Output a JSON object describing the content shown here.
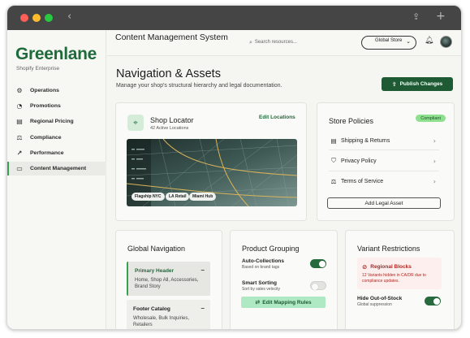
{
  "brand": {
    "name": "Greenlane",
    "subtitle": "Shopify Enterprise"
  },
  "sidebar": {
    "items": [
      {
        "label": "Operations",
        "icon": "sliders-icon",
        "glyph": "⚙"
      },
      {
        "label": "Promotions",
        "icon": "megaphone-icon",
        "glyph": "◔"
      },
      {
        "label": "Regional Pricing",
        "icon": "price-tag-icon",
        "glyph": "▤"
      },
      {
        "label": "Compliance",
        "icon": "gavel-icon",
        "glyph": "⚖"
      },
      {
        "label": "Performance",
        "icon": "trend-icon",
        "glyph": "↗"
      },
      {
        "label": "Content Management",
        "icon": "content-icon",
        "glyph": "▭",
        "active": true
      }
    ]
  },
  "header": {
    "app_title": "Content Management System",
    "search_placeholder": "Search resources...",
    "store_selector": "Global Store"
  },
  "page": {
    "title": "Navigation & Assets",
    "subtitle": "Manage your shop's structural hierarchy and legal documentation.",
    "publish_label": "Publish Changes"
  },
  "shop_locator": {
    "title": "Shop Locator",
    "subtitle": "42 Active Locations",
    "edit_label": "Edit Locations",
    "chips": [
      "Flagship NYC",
      "LA Retail",
      "Miami Hub"
    ]
  },
  "store_policies": {
    "title": "Store Policies",
    "badge": "Compliant",
    "items": [
      {
        "label": "Shipping & Returns",
        "icon": "clipboard-icon",
        "glyph": "▤"
      },
      {
        "label": "Privacy Policy",
        "icon": "shield-icon",
        "glyph": "⛉"
      },
      {
        "label": "Terms of Service",
        "icon": "gavel-icon",
        "glyph": "⚖"
      }
    ],
    "add_label": "Add Legal Asset"
  },
  "global_navigation": {
    "title": "Global Navigation",
    "menus": [
      {
        "title": "Primary Header",
        "desc": "Home, Shop All, Accessories, Brand Story"
      },
      {
        "title": "Footer Catalog",
        "desc": "Wholesale, Bulk Inquiries, Retailers"
      }
    ]
  },
  "product_grouping": {
    "title": "Product Grouping",
    "options": [
      {
        "title": "Auto-Collections",
        "sub": "Based on brand tags",
        "on": true
      },
      {
        "title": "Smart Sorting",
        "sub": "Sort by sales velocity",
        "on": false
      }
    ],
    "edit_label": "Edit Mapping Rules"
  },
  "variant_restrictions": {
    "title": "Variant Restrictions",
    "alert_title": "Regional Blocks",
    "alert_desc": "12 Variants hidden in CA/DR due to compliance updates.",
    "option_title": "Hide Out-of-Stock",
    "option_sub": "Global suppression",
    "option_on": true
  },
  "colors": {
    "accent": "#1f6b3b",
    "publish": "#1e5a34",
    "danger": "#b3261e",
    "compliant": "#8ee08e"
  }
}
